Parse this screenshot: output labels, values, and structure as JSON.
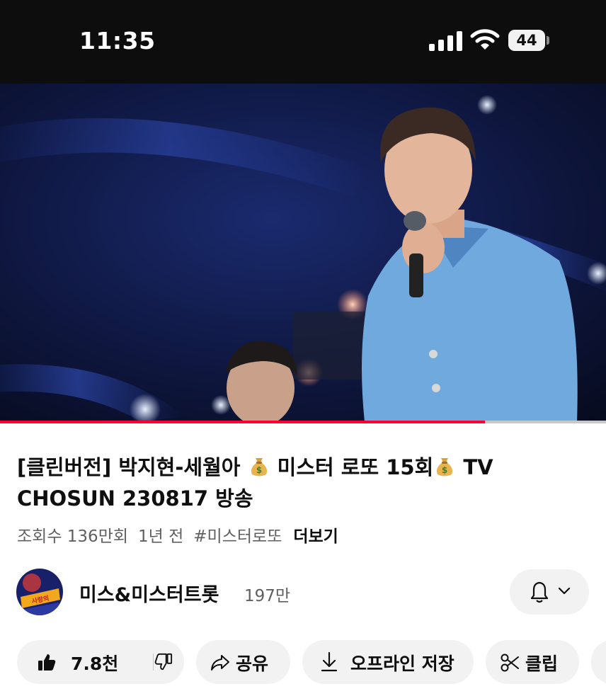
{
  "status_bar": {
    "time": "11:35",
    "battery": "44"
  },
  "video": {
    "progress": 0.8
  },
  "info": {
    "title_part1": "[클린버전] 박지현-세월아 ",
    "title_part2": "미스터 로또 15회",
    "title_part3": " TV CHOSUN 230817 방송",
    "views": "조회수 136만회",
    "age": "1년 전",
    "hashtag": "#미스터로또",
    "more": "더보기"
  },
  "channel": {
    "name": "미스&미스터트롯",
    "subscribers": "197만",
    "avatar_text": "사랑의 콜센타"
  },
  "actions": {
    "like_count": "7.8천",
    "share": "공유",
    "offline_save": "오프라인 저장",
    "clip": "클립"
  },
  "icons": [
    "signal-icon",
    "wifi-icon",
    "battery-icon",
    "moneybag-icon",
    "bell-icon",
    "chevron-down-icon",
    "like-icon",
    "dislike-icon",
    "share-icon",
    "download-icon",
    "scissors-icon"
  ],
  "colors": {
    "status_bg": "#0d0d0d",
    "progress": "#ff0033",
    "pill_bg": "#f2f2f2",
    "text": "#0f0f0f",
    "muted": "#606060"
  }
}
